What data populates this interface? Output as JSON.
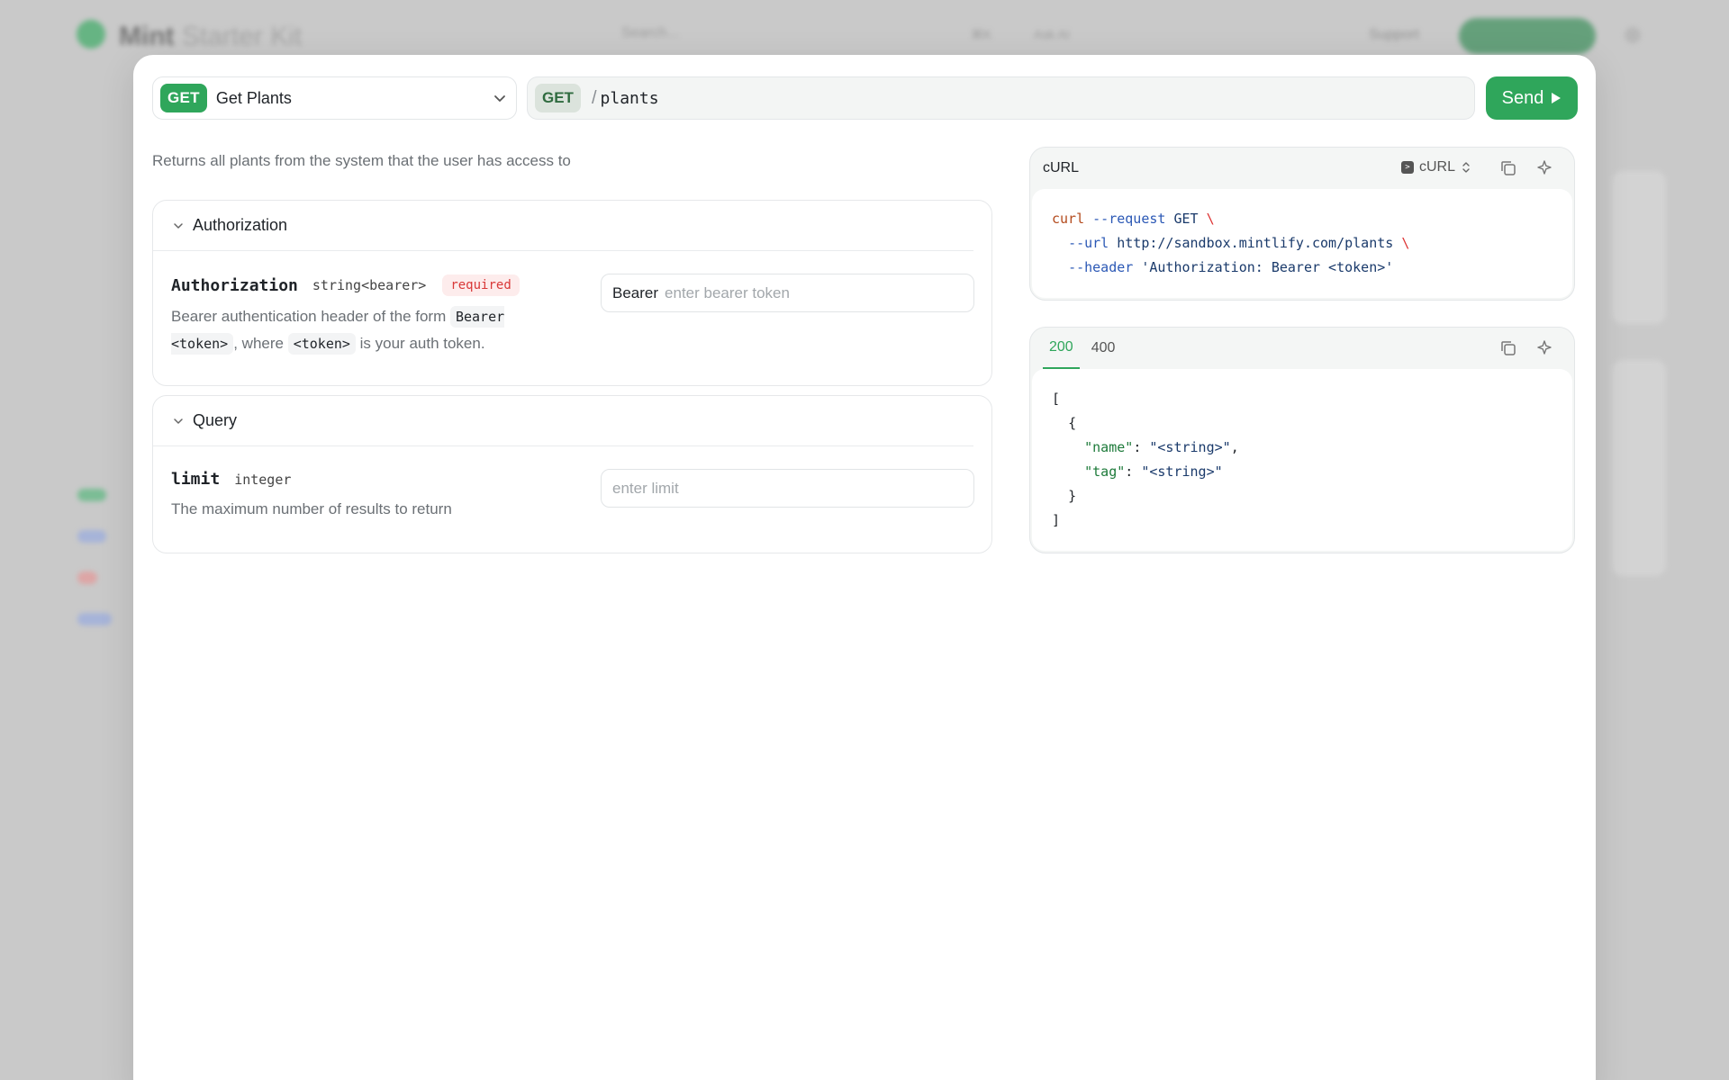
{
  "background": {
    "brand_strong": "Mint",
    "brand_light": "Starter Kit",
    "search_placeholder": "Search...",
    "shortcut": "⌘K",
    "ask_label": "Ask AI",
    "support_label": "Support"
  },
  "endpoint": {
    "method": "GET",
    "name": "Get Plants"
  },
  "url": {
    "method": "GET",
    "slash": "/",
    "path": "plants"
  },
  "send_label": "Send",
  "description": "Returns all plants from the system that the user has access to",
  "sections": {
    "authorization": {
      "title": "Authorization",
      "param_name": "Authorization",
      "param_type": "string<bearer>",
      "required_label": "required",
      "desc_prefix": "Bearer authentication header of the form ",
      "desc_code1": "Bearer <token>",
      "desc_mid": ", where ",
      "desc_code2": "<token>",
      "desc_suffix": " is your auth token.",
      "field_prefix": "Bearer",
      "field_placeholder": "enter bearer token"
    },
    "query": {
      "title": "Query",
      "param_name": "limit",
      "param_type": "integer",
      "desc": "The maximum number of results to return",
      "field_placeholder": "enter limit"
    }
  },
  "code_panel": {
    "title": "cURL",
    "language": "cURL",
    "lines": {
      "l1_cmd": "curl",
      "l1_flag": "--request",
      "l1_val": "GET",
      "l2_flag": "--url",
      "l2_val": "http://sandbox.mintlify.com/plants",
      "l3_flag": "--header",
      "l3_val": "'Authorization: Bearer <token>'",
      "bs": "\\"
    }
  },
  "response_panel": {
    "tabs": [
      "200",
      "400"
    ],
    "active_tab": "200",
    "json": {
      "open_bracket": "[",
      "open_brace": "{",
      "key1": "\"name\"",
      "val1": "\"<string>\"",
      "key2": "\"tag\"",
      "val2": "\"<string>\"",
      "close_brace": "}",
      "close_bracket": "]"
    }
  },
  "colors": {
    "accent": "#2fa65b",
    "required": "#d93838"
  }
}
